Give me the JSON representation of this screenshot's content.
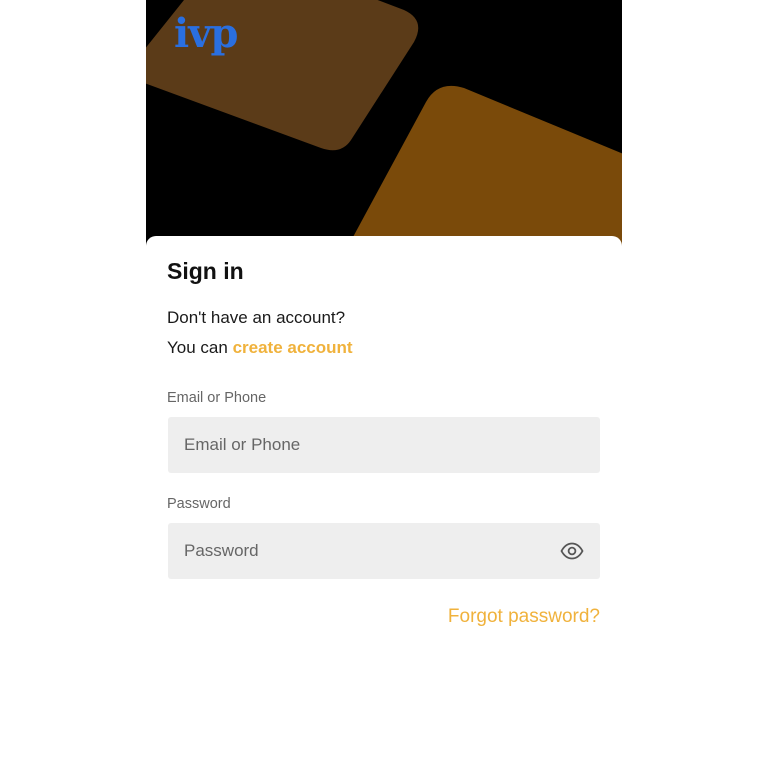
{
  "brand": {
    "logo_text": "ivp",
    "logo_color": "#2a6fe0"
  },
  "colors": {
    "accent": "#f0b23c",
    "hero_background": "#000000",
    "hero_card_top": "#5b3b18",
    "hero_card_bottom": "#7a4a0a",
    "input_background": "#eeeeee"
  },
  "signin": {
    "title": "Sign in",
    "no_account_text": "Don't have an account?",
    "you_can_text": "You can",
    "create_account_link": "create account",
    "email_label": "Email or Phone",
    "email_placeholder": "Email or Phone",
    "email_value": "",
    "password_label": "Password",
    "password_placeholder": "Password",
    "password_value": "",
    "password_toggle_icon": "eye-icon",
    "forgot_password_link": "Forgot password?"
  }
}
